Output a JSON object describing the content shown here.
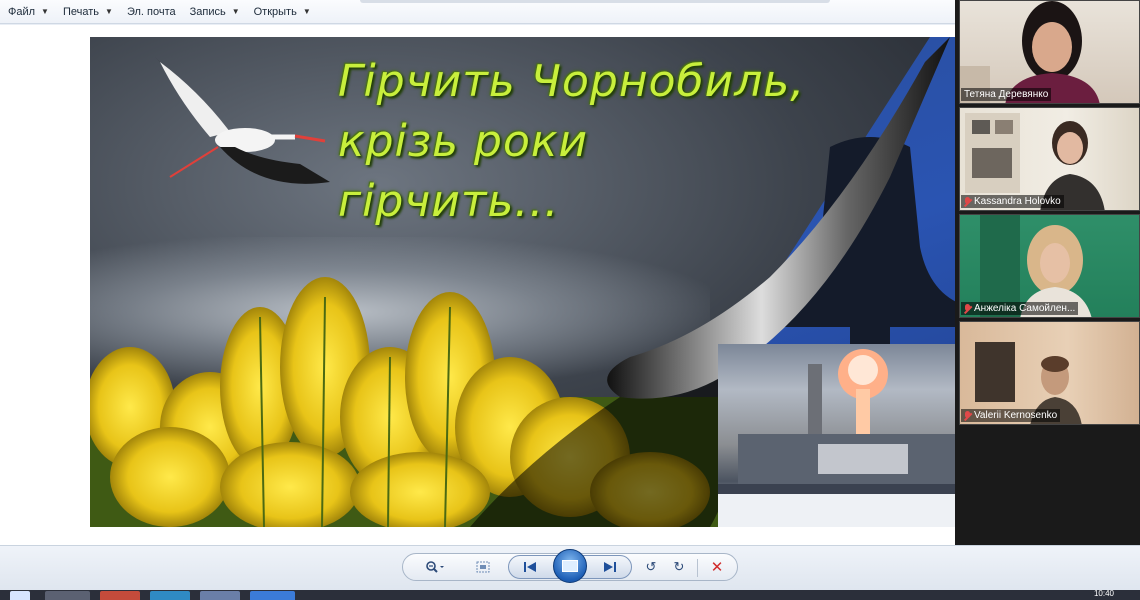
{
  "menu": {
    "items": [
      {
        "label": "Файл"
      },
      {
        "label": "Печать"
      },
      {
        "label": "Эл. почта"
      },
      {
        "label": "Запись"
      },
      {
        "label": "Открыть"
      }
    ]
  },
  "slide": {
    "title_lines": [
      "Гірчить Чорнобиль,",
      "крізь роки",
      "гірчить..."
    ]
  },
  "participants": [
    {
      "name": "Тетяна Деревянко",
      "muted": false
    },
    {
      "name": "Kassandra Holovko",
      "muted": true
    },
    {
      "name": "Анжеліка Самойлен...",
      "muted": true
    },
    {
      "name": "Valerii Kernosenko",
      "muted": true
    }
  ],
  "taskbar": {
    "clock": "10:40"
  },
  "colors": {
    "title_text": "#c8ef3c",
    "panel_bg": "#1a1a1a",
    "muted_mic": "#e04848"
  }
}
